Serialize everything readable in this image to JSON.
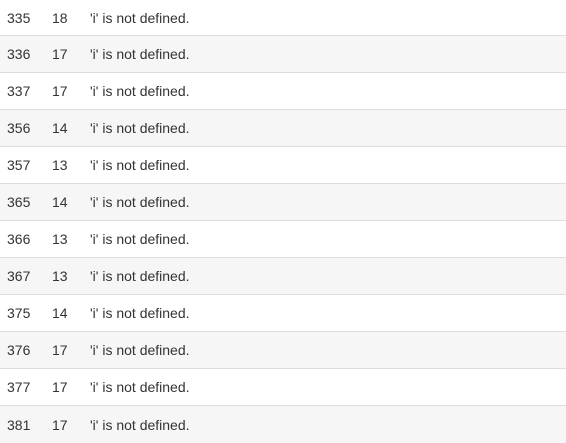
{
  "lint_rows": [
    {
      "line": "335",
      "column": "18",
      "message": "'i' is not defined."
    },
    {
      "line": "336",
      "column": "17",
      "message": "'i' is not defined."
    },
    {
      "line": "337",
      "column": "17",
      "message": "'i' is not defined."
    },
    {
      "line": "356",
      "column": "14",
      "message": "'i' is not defined."
    },
    {
      "line": "357",
      "column": "13",
      "message": "'i' is not defined."
    },
    {
      "line": "365",
      "column": "14",
      "message": "'i' is not defined."
    },
    {
      "line": "366",
      "column": "13",
      "message": "'i' is not defined."
    },
    {
      "line": "367",
      "column": "13",
      "message": "'i' is not defined."
    },
    {
      "line": "375",
      "column": "14",
      "message": "'i' is not defined."
    },
    {
      "line": "376",
      "column": "17",
      "message": "'i' is not defined."
    },
    {
      "line": "377",
      "column": "17",
      "message": "'i' is not defined."
    },
    {
      "line": "381",
      "column": "17",
      "message": "'i' is not defined."
    }
  ]
}
